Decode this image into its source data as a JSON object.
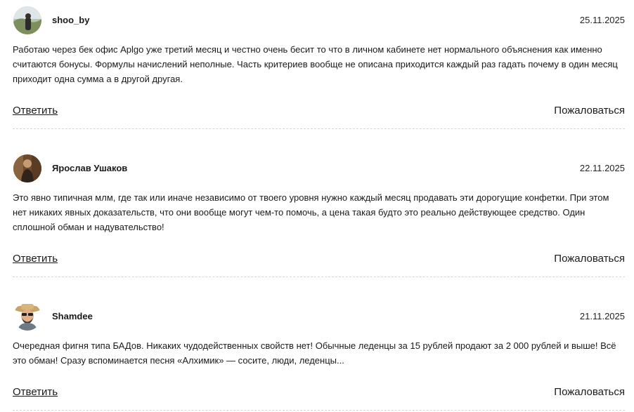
{
  "comments": [
    {
      "author": "shoo_by",
      "date": "25.11.2025",
      "text": "Работаю через бек офис Aplgo уже третий месяц и честно очень бесит то что в личном кабинете нет нормального объяснения как именно считаются бонусы. Формулы начислений неполные. Часть критериев вообще не описана приходится каждый раз гадать почему в один месяц приходит одна сумма а в другой другая.",
      "reply_label": "Ответить",
      "report_label": "Пожаловаться"
    },
    {
      "author": "Ярослав Ушаков",
      "date": "22.11.2025",
      "text": "Это явно типичная млм, где так или иначе независимо от твоего уровня нужно каждый месяц продавать эти дорогущие конфетки. При этом нет никаких явных доказательств, что они вообще могут чем-то помочь, а цена такая будто это реально действующее средство. Один сплошной обман и надувательство!",
      "reply_label": "Ответить",
      "report_label": "Пожаловаться"
    },
    {
      "author": "Shamdee",
      "date": "21.11.2025",
      "text": "Очередная фигня типа БАДов. Никаких чудодейственных свойств нет! Обычные леденцы за 15 рублей продают за 2 000 рублей и выше! Всё это обман! Сразу вспоминается песня «Алхимик» — сосите, люди, леденцы...",
      "reply_label": "Ответить",
      "report_label": "Пожаловаться"
    }
  ]
}
